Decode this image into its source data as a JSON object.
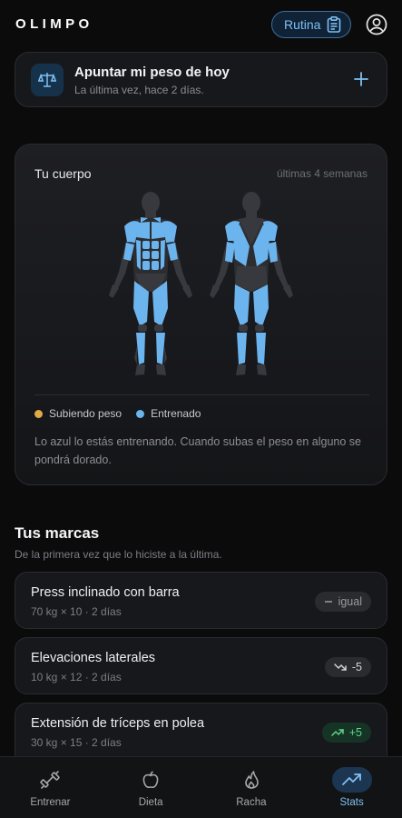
{
  "app": {
    "logo": "OLIMPO"
  },
  "header": {
    "routine_label": "Rutina",
    "routine_icon": "clipboard-icon",
    "profile_icon": "user-circle-icon"
  },
  "weight_card": {
    "title": "Apuntar mi peso de hoy",
    "subtitle": "La última vez, hace 2 días.",
    "icon": "scale-icon",
    "action_icon": "plus-icon"
  },
  "body_card": {
    "title": "Tu cuerpo",
    "range": "últimas 4 semanas",
    "legend": [
      {
        "label": "Subiendo peso",
        "color": "#e3a948"
      },
      {
        "label": "Entrenado",
        "color": "#6bb4ee"
      }
    ],
    "note": "Lo azul lo estás entrenando. Cuando subas el peso en alguno se pondrá dorado.",
    "colors": {
      "trained": "#6bb4ee",
      "untrained": "#38393e"
    }
  },
  "marks": {
    "title": "Tus marcas",
    "subtitle": "De la primera vez que lo hiciste a la última.",
    "records": [
      {
        "name": "Press inclinado con barra",
        "detail": "70 kg × 10 · 2 días",
        "badge": "igual",
        "trend": "equal"
      },
      {
        "name": "Elevaciones laterales",
        "detail": "10 kg × 12 · 2 días",
        "badge": "-5",
        "trend": "down"
      },
      {
        "name": "Extensión de tríceps en polea",
        "detail": "30 kg × 15 · 2 días",
        "badge": "+5",
        "trend": "up"
      }
    ]
  },
  "tabs": [
    {
      "label": "Entrenar",
      "icon": "dumbbell-icon",
      "active": false
    },
    {
      "label": "Dieta",
      "icon": "apple-icon",
      "active": false
    },
    {
      "label": "Racha",
      "icon": "flame-icon",
      "active": false
    },
    {
      "label": "Stats",
      "icon": "trending-up-icon",
      "active": true
    }
  ],
  "colors": {
    "accent": "#7fc0f4",
    "background": "#0b0b0c",
    "card": "#17181b",
    "up": "#5fd38a"
  }
}
